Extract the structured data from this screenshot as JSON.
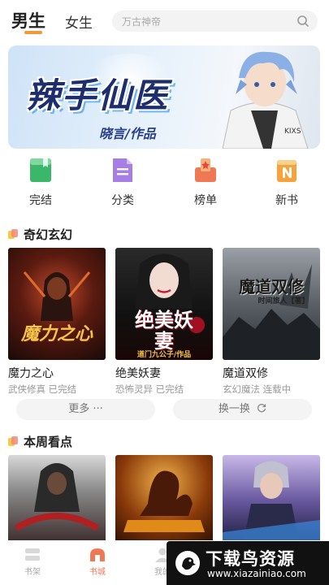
{
  "header": {
    "tab_male": "男生",
    "tab_female": "女生",
    "search_placeholder": "万古神帝"
  },
  "banner": {
    "title": "辣手仙医",
    "author": "晓言/作品"
  },
  "categories": [
    {
      "label": "完结",
      "icon": "book-icon",
      "color": "#3bb76a"
    },
    {
      "label": "分类",
      "icon": "document-icon",
      "color": "#a77de6"
    },
    {
      "label": "榜单",
      "icon": "ranking-icon",
      "color": "#f07855"
    },
    {
      "label": "新书",
      "icon": "new-badge-icon",
      "color": "#f7a23a"
    }
  ],
  "section1": {
    "title": "奇幻玄幻",
    "books": [
      {
        "title": "魔力之心",
        "meta": "武侠修真 已完结",
        "cover_text": "魔力之心"
      },
      {
        "title": "绝美妖妻",
        "meta": "恐怖灵异 已完结",
        "cover_text": "绝美妖妻",
        "cover_sub": "道门九公子/作品"
      },
      {
        "title": "魔道双修",
        "meta": "玄幻魔法 连载中",
        "cover_text": "魔道双修",
        "cover_sub": "时间旅人【著】"
      }
    ],
    "more_label": "更多 ···",
    "refresh_label": "换一换"
  },
  "section2": {
    "title": "本周看点"
  },
  "bottom_nav": [
    {
      "label": "书架",
      "icon": "bookshelf-icon"
    },
    {
      "label": "书城",
      "icon": "bookstore-icon"
    },
    {
      "label": "我的",
      "icon": "profile-icon"
    }
  ],
  "watermark": {
    "name": "下载鸟资源",
    "url": "www.xiazainiao.com"
  },
  "colors": {
    "accent": "#f29a3a",
    "nav_active": "#f07855"
  }
}
